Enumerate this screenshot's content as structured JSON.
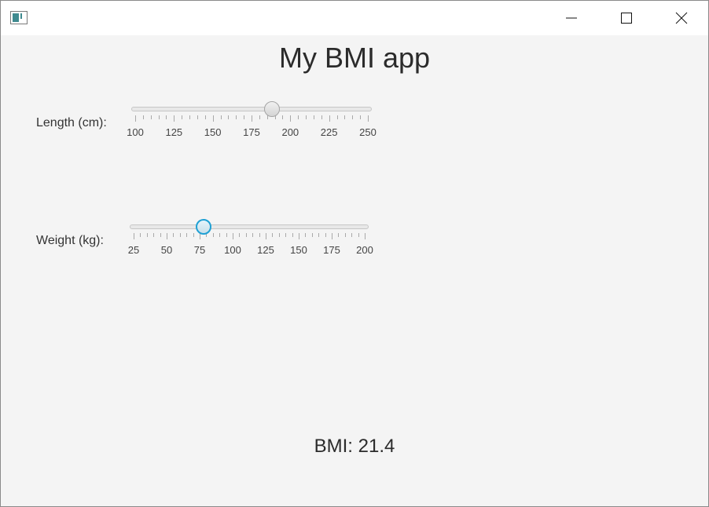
{
  "window": {
    "controls": {
      "minimize": "minimize-icon",
      "maximize": "maximize-icon",
      "close": "close-icon"
    }
  },
  "app": {
    "title": "My BMI app"
  },
  "length": {
    "label": "Length (cm):",
    "min": 100,
    "max": 250,
    "value": 188,
    "major_tick_labels": [
      "100",
      "125",
      "150",
      "175",
      "200",
      "225",
      "250"
    ]
  },
  "weight": {
    "label": "Weight (kg):",
    "min": 25,
    "max": 200,
    "value": 78,
    "major_tick_labels": [
      "25",
      "50",
      "75",
      "100",
      "125",
      "150",
      "175",
      "200"
    ]
  },
  "bmi": {
    "text": "BMI: 21.4"
  }
}
